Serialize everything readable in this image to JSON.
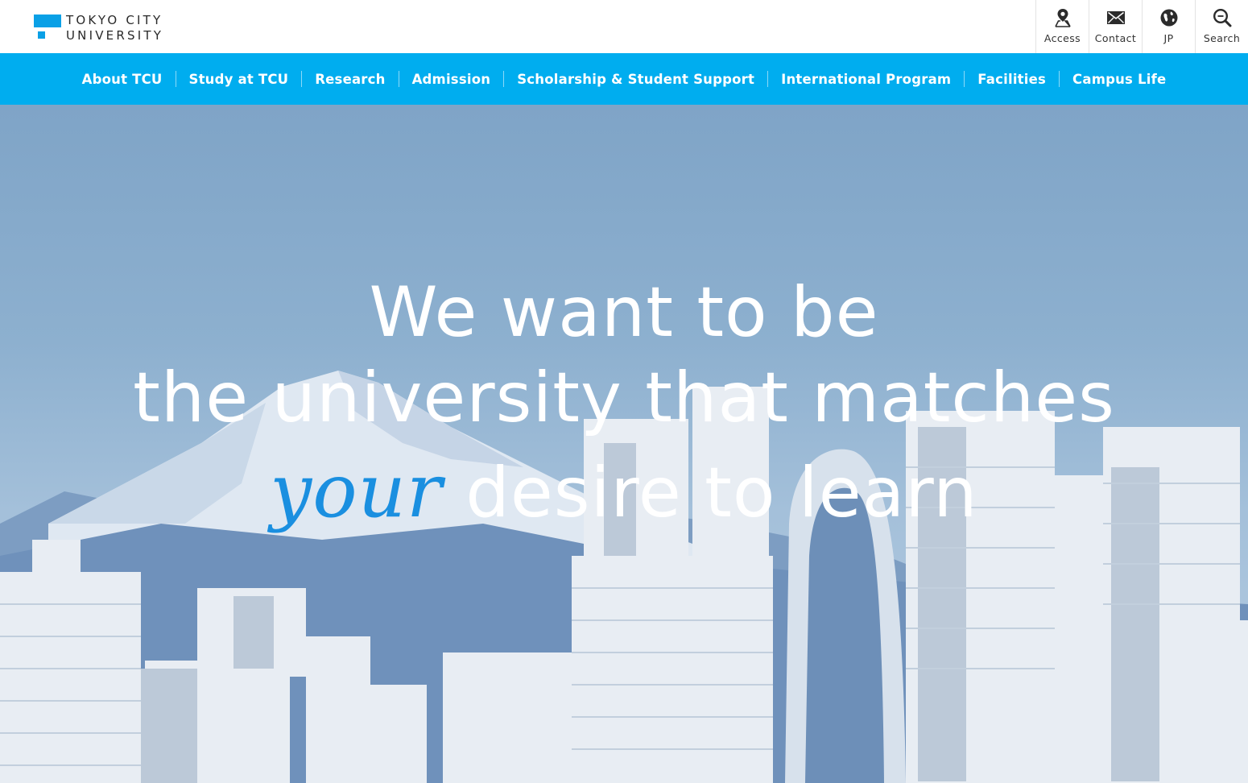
{
  "site": {
    "logo_line1": "TOKYO CITY",
    "logo_line2": "UNIVERSITY",
    "brand_color": "#0aa0e6"
  },
  "utility": [
    {
      "label": "Access",
      "icon": "map-pin-icon"
    },
    {
      "label": "Contact",
      "icon": "envelope-icon"
    },
    {
      "label": "JP",
      "icon": "globe-icon"
    },
    {
      "label": "Search",
      "icon": "search-icon"
    }
  ],
  "nav": {
    "color": "#00adef",
    "items": [
      {
        "label": "About TCU"
      },
      {
        "label": "Study at TCU"
      },
      {
        "label": "Research"
      },
      {
        "label": "Admission"
      },
      {
        "label": "Scholarship & Student Support"
      },
      {
        "label": "International Program"
      },
      {
        "label": "Facilities"
      },
      {
        "label": "Campus Life"
      }
    ]
  },
  "hero": {
    "line1": "We want to be",
    "line2": "the university that matches",
    "line3_accent": "your",
    "line3_rest": "desire to learn",
    "accent_color": "#1a8fe0"
  }
}
